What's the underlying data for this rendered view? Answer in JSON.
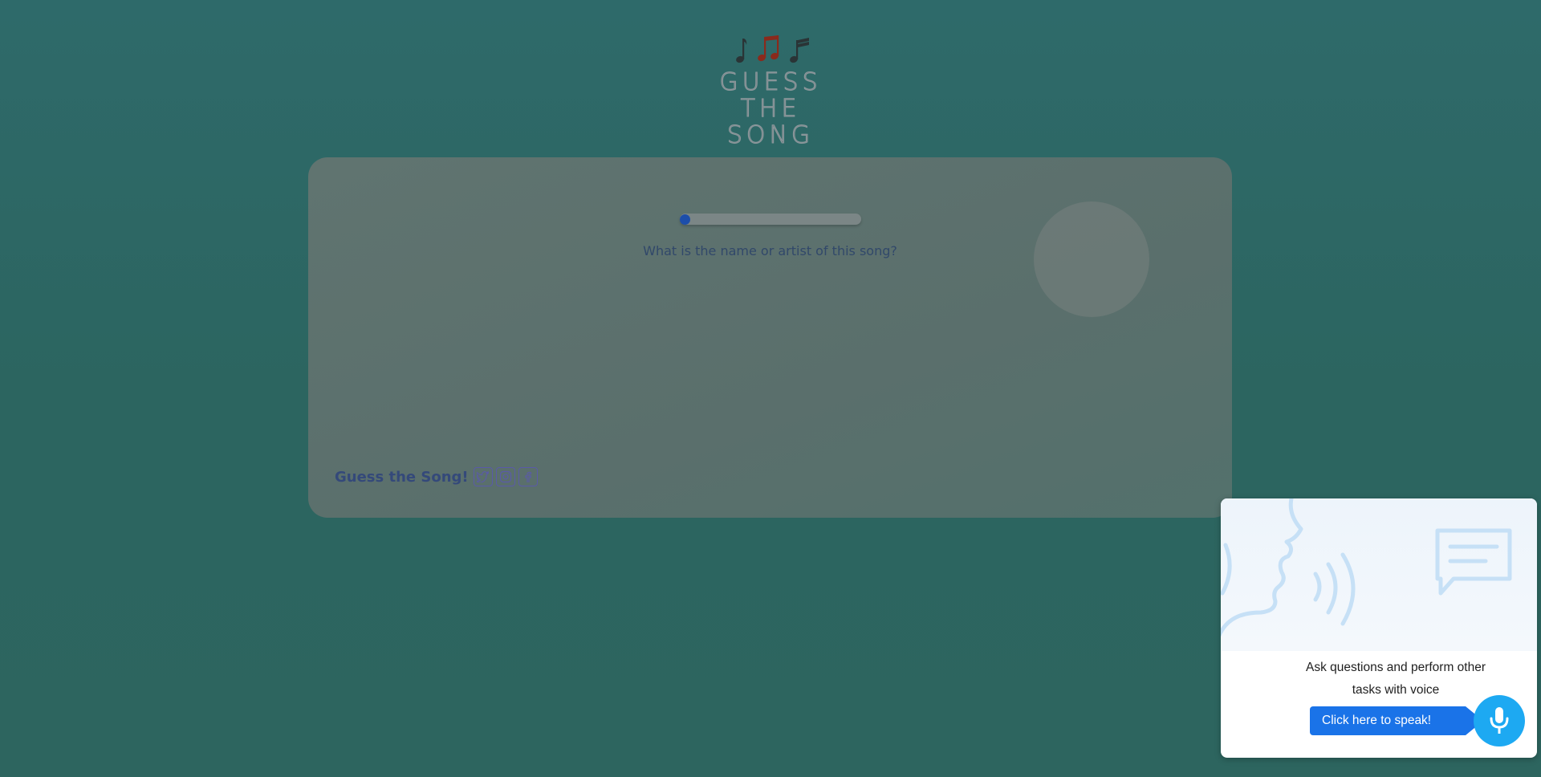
{
  "header": {
    "notes": [
      "♩",
      "♫",
      "♪"
    ],
    "title_line1": "GUESS THE",
    "title_line2": "SONG"
  },
  "game": {
    "progress_fraction": 0.0,
    "question": "What is the name or artist of this song?",
    "footer_brand": "Guess the Song!",
    "social_icons": [
      "twitter-icon",
      "instagram-icon",
      "facebook-icon"
    ]
  },
  "voice_widget": {
    "text_line1": "Ask questions and perform other",
    "text_line2": "tasks with voice",
    "speak_label": "Click here to speak!"
  },
  "colors": {
    "background": "#2d6764",
    "card": "#5b706d",
    "accent_blue": "#1a73e8",
    "mic_blue": "#1da9f2",
    "note_red": "#8a2a1c",
    "note_dark": "#2a3436"
  }
}
